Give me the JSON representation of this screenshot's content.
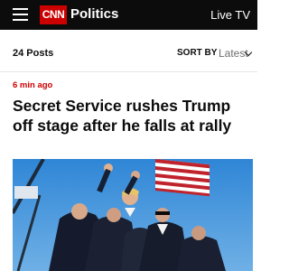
{
  "header": {
    "logo_text": "CNN",
    "section": "Politics",
    "live_tv": "Live TV",
    "menu_icon": "hamburger-menu-icon",
    "background": "#0c0c0c",
    "brand_color": "#cc0000"
  },
  "posts": {
    "count_label": "24 Posts",
    "sort_label": "SORT BY",
    "sort_value": "Latest",
    "sort_icon": "chevron-down-icon"
  },
  "article": {
    "timestamp": "6 min ago",
    "headline": "Secret Service rushes Trump off stage after he falls at rally",
    "timestamp_color": "#cc0000"
  }
}
